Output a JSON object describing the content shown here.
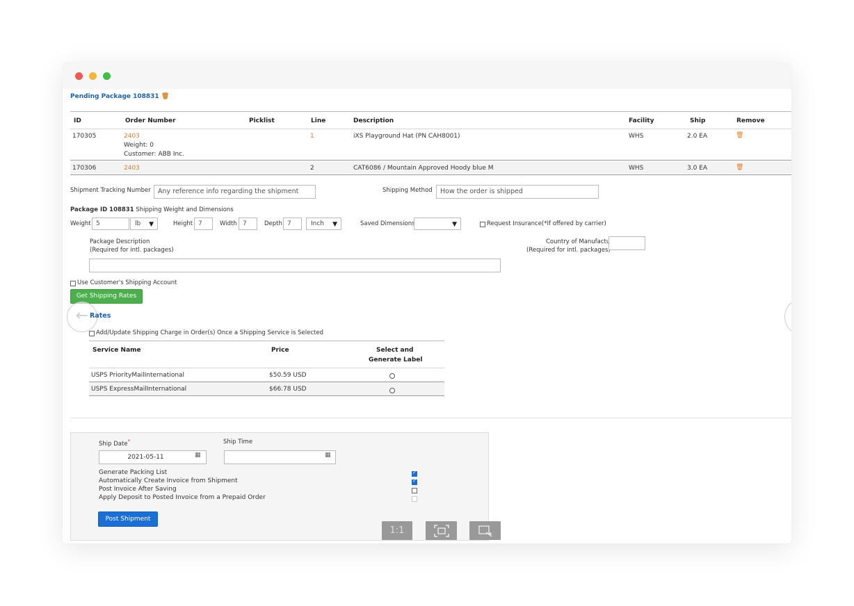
{
  "window": {
    "dots": {
      "red": "#ee5b52",
      "yellow": "#f0b53a",
      "green": "#3fbe47"
    }
  },
  "package": {
    "title": "Pending Package 108831"
  },
  "items_table": {
    "headers": [
      "ID",
      "Order Number",
      "Picklist",
      "Line",
      "Description",
      "Facility",
      "Ship",
      "Remove"
    ],
    "rows": [
      {
        "id": "170305",
        "order": "2403",
        "weight": "Weight: 0",
        "customer": "Customer: ABB Inc.",
        "picklist": "",
        "line": "1",
        "description": "iXS Playground Hat (PN CAH8001)",
        "facility": "WHS",
        "ship": "2.0 EA"
      },
      {
        "id": "170306",
        "order": "2403",
        "picklist": "",
        "line": "2",
        "description": "CAT6086 / Mountain Approved Hoody blue M",
        "facility": "WHS",
        "ship": "3.0 EA"
      }
    ]
  },
  "shipment": {
    "tracking_label": "Shipment Tracking Number",
    "tracking_placeholder": "Any reference info regarding the shipment",
    "method_label": "Shipping Method",
    "method_placeholder": "How the order is shipped"
  },
  "dims": {
    "heading_bold": "Package ID 108831",
    "heading_rest": "Shipping Weight and Dimensions",
    "weight_label": "Weight",
    "weight_value": "5",
    "weight_unit": "lb",
    "height_label": "Height",
    "height_value": "7",
    "width_label": "Width",
    "width_value": "7",
    "depth_label": "Depth",
    "depth_value": "7",
    "dim_unit": "Inch",
    "saved_label": "Saved Dimensions",
    "saved_value": "",
    "insurance_label": "Request Insurance(*If offered by carrier)",
    "desc_label_1": "Package Description",
    "desc_label_2": "(Required for intl. packages)",
    "country_label_1": "Country of Manufacture",
    "country_label_2": "(Required for intl. packages)",
    "customer_account_label": "Use Customer's Shipping Account",
    "get_rates_button": "Get Shipping Rates"
  },
  "rates": {
    "title": "Rates",
    "add_charge_label": "Add/Update Shipping Charge in Order(s) Once a Shipping Service is Selected",
    "headers": {
      "service": "Service Name",
      "price": "Price",
      "select_1": "Select and",
      "select_2": "Generate Label"
    },
    "rows": [
      {
        "service": "USPS PriorityMailInternational",
        "price": "$50.59 USD"
      },
      {
        "service": "USPS ExpressMailInternational",
        "price": "$66.78 USD"
      }
    ]
  },
  "post": {
    "ship_date_label": "Ship Date",
    "required_mark": "*",
    "ship_date_value": "2021-05-11",
    "ship_time_label": "Ship Time",
    "ship_time_value": "",
    "options": [
      {
        "label": "Generate Packing List",
        "checked": true
      },
      {
        "label": "Automatically Create Invoice from Shipment",
        "checked": true
      },
      {
        "label": "Post Invoice After Saving",
        "checked": false
      },
      {
        "label": "Apply Deposit to Posted Invoice from a Prepaid Order",
        "checked": false,
        "disabled": true
      }
    ],
    "post_button": "Post Shipment"
  },
  "viewer_controls": {
    "one_to_one": "1:1",
    "fit_icon": "fit-screen-icon",
    "crop_icon": "screenshot-crop-icon"
  },
  "icons": {
    "trash": "trash-icon",
    "calendar": "calendar-icon",
    "back_arrow": "back-arrow-icon",
    "chevron": "chevron-down-icon"
  },
  "colors": {
    "link": "#1f5fa8",
    "orange": "#d9822b",
    "green_button": "#4cae4c",
    "blue_button": "#1a6fd4"
  }
}
